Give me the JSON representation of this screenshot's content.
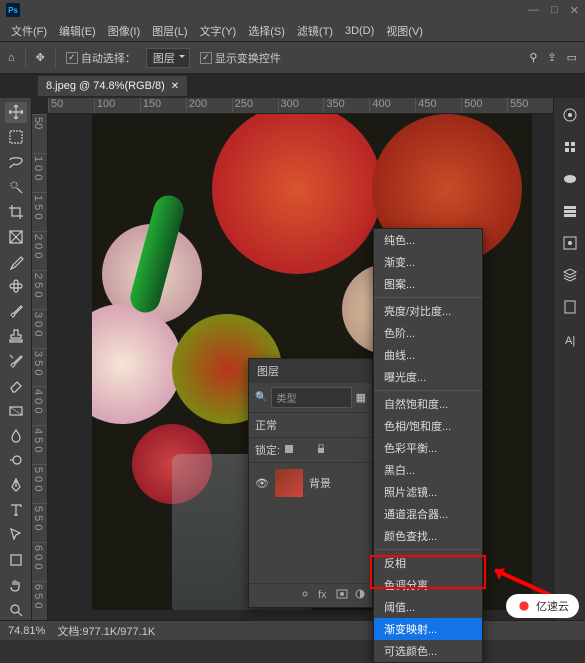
{
  "menu": {
    "file": "文件(F)",
    "edit": "编辑(E)",
    "image": "图像(I)",
    "layer": "图层(L)",
    "type": "文字(Y)",
    "select": "选择(S)",
    "filter": "滤镜(T)",
    "threed": "3D(D)",
    "view": "视图(V)"
  },
  "optbar": {
    "auto_select": "自动选择：",
    "target": "图层",
    "show_transform": "显示变换控件"
  },
  "tab": {
    "title": "8.jpeg @ 74.8%(RGB/8)"
  },
  "ruler_h": [
    "50",
    "100",
    "150",
    "200",
    "250",
    "300",
    "350",
    "400",
    "450",
    "500",
    "550"
  ],
  "ruler_v": [
    "50",
    "1 0 0",
    "1 5 0",
    "2 0 0",
    "2 5 0",
    "3 0 0",
    "3 5 0",
    "4 0 0",
    "4 5 0",
    "5 0 0",
    "5 5 0",
    "6 0 0",
    "6 5 0"
  ],
  "layers": {
    "panel_title": "图层",
    "search_label": "类型",
    "blend_mode": "正常",
    "lock_label": "锁定:",
    "bg_layer": "背景"
  },
  "ctx": {
    "solid": "纯色...",
    "gradient": "渐变...",
    "pattern": "图案...",
    "brightness": "亮度/对比度...",
    "levels": "色阶...",
    "curves": "曲线...",
    "exposure": "曝光度...",
    "vibrance": "自然饱和度...",
    "hue": "色相/饱和度...",
    "colorbal": "色彩平衡...",
    "bw": "黑白...",
    "photofilter": "照片滤镜...",
    "channelmix": "通道混合器...",
    "colorlookup": "颜色查找...",
    "invert": "反相",
    "posterize": "色调分离...",
    "threshold": "阈值...",
    "gradmap": "渐变映射...",
    "selcolor": "可选颜色..."
  },
  "status": {
    "zoom": "74.81%",
    "doc": "文档:977.1K/977.1K"
  },
  "watermark": "亿速云"
}
